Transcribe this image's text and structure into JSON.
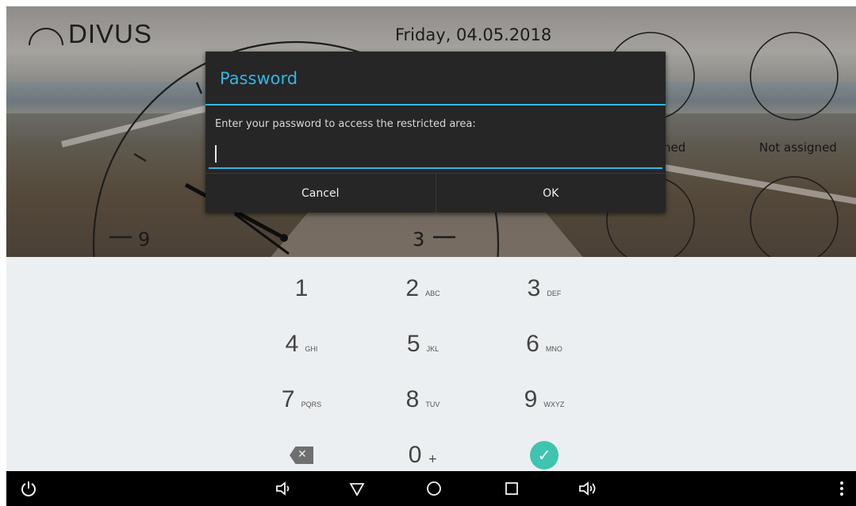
{
  "header": {
    "logo_text": "DIVUS",
    "date": "Friday, 04.05.2018"
  },
  "clock": {
    "labels": [
      "9",
      "3"
    ]
  },
  "slots": {
    "partial_label": "ned",
    "label": "Not assigned"
  },
  "dialog": {
    "title": "Password",
    "message": "Enter your password to access the restricted area:",
    "input_value": "",
    "cancel_label": "Cancel",
    "ok_label": "OK"
  },
  "keypad": {
    "keys": [
      {
        "num": "1",
        "sub": ""
      },
      {
        "num": "2",
        "sub": "ABC"
      },
      {
        "num": "3",
        "sub": "DEF"
      },
      {
        "num": "4",
        "sub": "GHI"
      },
      {
        "num": "5",
        "sub": "JKL"
      },
      {
        "num": "6",
        "sub": "MNO"
      },
      {
        "num": "7",
        "sub": "PQRS"
      },
      {
        "num": "8",
        "sub": "TUV"
      },
      {
        "num": "9",
        "sub": "WXYZ"
      }
    ],
    "zero": "0",
    "zero_sub": "+"
  },
  "navbar": {
    "icons": [
      "power-icon",
      "volume-down-icon",
      "back-icon",
      "home-icon",
      "recents-icon",
      "volume-up-icon",
      "overflow-menu-icon"
    ]
  },
  "colors": {
    "accent": "#33b5e5",
    "confirm": "#3fc4b0",
    "dialog_bg": "#262626",
    "keypad_bg": "#eceff1"
  }
}
